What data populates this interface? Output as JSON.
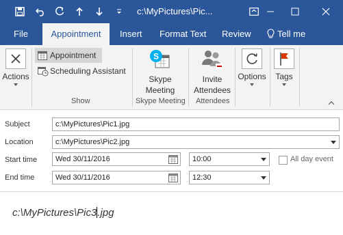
{
  "window": {
    "title": "c:\\MyPictures\\Pic..."
  },
  "menu": {
    "tabs": [
      {
        "label": "File"
      },
      {
        "label": "Appointment"
      },
      {
        "label": "Insert"
      },
      {
        "label": "Format Text"
      },
      {
        "label": "Review"
      }
    ],
    "tell_me": "Tell me"
  },
  "ribbon": {
    "actions_label": "Actions",
    "appointment_label": "Appointment",
    "scheduling_label": "Scheduling Assistant",
    "show_group": "Show",
    "skype_line1": "Skype",
    "skype_line2": "Meeting",
    "skype_group": "Skype Meeting",
    "invite_line1": "Invite",
    "invite_line2": "Attendees",
    "attendees_group": "Attendees",
    "options_label": "Options",
    "tags_label": "Tags"
  },
  "form": {
    "subject_label": "Subject",
    "subject_value": "c:\\MyPictures\\Pic1.jpg",
    "location_label": "Location",
    "location_value": "c:\\MyPictures\\Pic2.jpg",
    "start_label": "Start time",
    "start_date": "Wed 30/11/2016",
    "start_time": "10:00",
    "all_day_label": "All day event",
    "end_label": "End time",
    "end_date": "Wed 30/11/2016",
    "end_time": "12:30"
  },
  "body": {
    "text_before_caret": "c:\\MyPictures\\Pic3",
    "text_after_caret": ".jpg"
  },
  "colors": {
    "accent": "#2b579a",
    "ribbon_bg": "#f3f3f3"
  }
}
